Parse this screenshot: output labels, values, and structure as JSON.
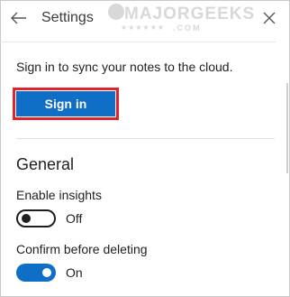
{
  "header": {
    "back_icon": "arrow-left-icon",
    "title": "Settings",
    "close_icon": "close-icon"
  },
  "watermark": {
    "brand": "MAJORGEEKS",
    "domain": ".COM",
    "stars": "★★★★★★"
  },
  "sync": {
    "message": "Sign in to sync your notes to the cloud.",
    "signin_label": "Sign in",
    "button_color": "#0f6fc6",
    "highlight_color": "#e0242c"
  },
  "general": {
    "heading": "General",
    "settings": [
      {
        "label": "Enable insights",
        "state": "Off",
        "on": false
      },
      {
        "label": "Confirm before deleting",
        "state": "On",
        "on": true
      }
    ]
  }
}
